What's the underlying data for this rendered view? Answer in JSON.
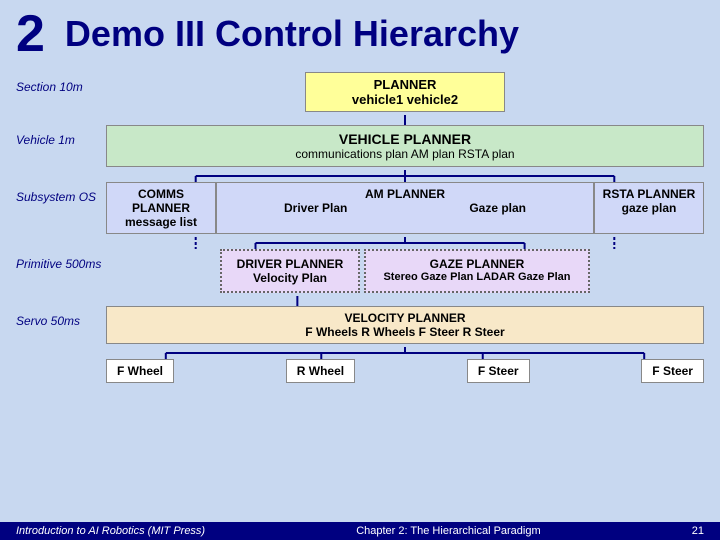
{
  "header": {
    "slide_number": "2",
    "title": "Demo III Control Hierarchy"
  },
  "rows": {
    "section": {
      "label": "Section 10m",
      "planner": {
        "line1": "PLANNER",
        "line2": "vehicle1  vehicle2"
      }
    },
    "vehicle": {
      "label": "Vehicle 1m",
      "box": {
        "line1": "VEHICLE PLANNER",
        "line2": "communications plan  AM plan   RSTA plan"
      }
    },
    "subsystem": {
      "label": "Subsystem OS",
      "comms": {
        "line1": "COMMS PLANNER",
        "line2": "message list"
      },
      "am": {
        "line1": "AM PLANNER",
        "line2": "Driver Plan",
        "line3": "Gaze plan"
      },
      "rsta": {
        "line1": "RSTA PLANNER",
        "line2": "gaze plan"
      }
    },
    "primitive": {
      "label": "Primitive 500ms",
      "driver": {
        "line1": "DRIVER PLANNER",
        "line2": "Velocity Plan"
      },
      "gaze": {
        "line1": "GAZE PLANNER",
        "line2": "Stereo Gaze Plan  LADAR Gaze Plan"
      }
    },
    "servo": {
      "label": "Servo 50ms",
      "velocity": {
        "line1": "VELOCITY PLANNER",
        "line2": "F Wheels  R Wheels  F Steer  R Steer"
      }
    },
    "actuator": {
      "label": "",
      "wheels": [
        "F Wheel",
        "R Wheel",
        "F Steer",
        "F Steer"
      ]
    }
  },
  "footer": {
    "left": "Introduction to AI Robotics (MIT Press)",
    "center": "Chapter 2: The Hierarchical Paradigm",
    "page": "21"
  }
}
